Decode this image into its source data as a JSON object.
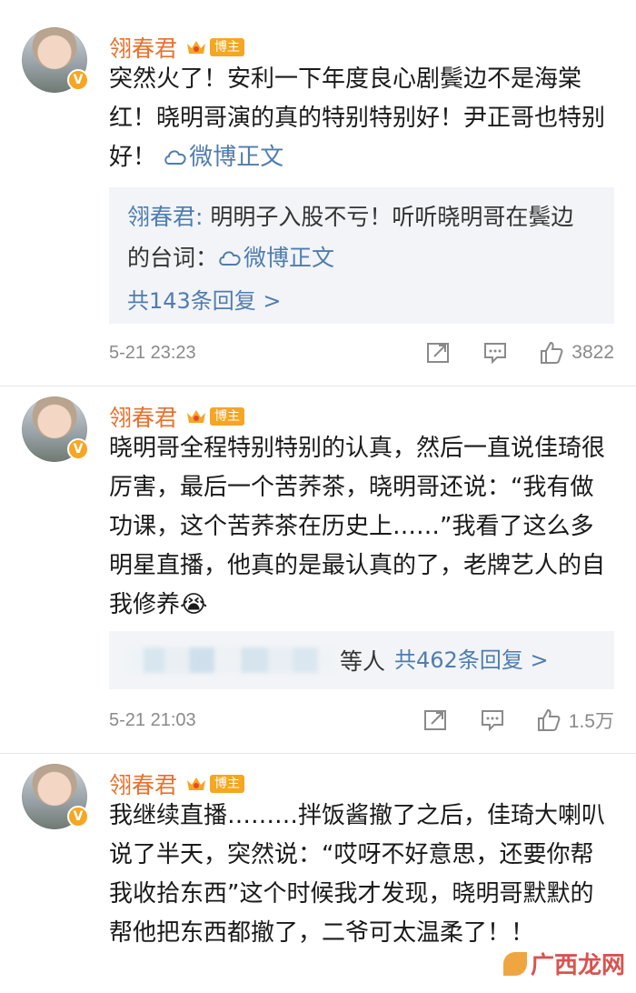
{
  "posts": [
    {
      "username": "翎春君",
      "tag": "博主",
      "text": "突然火了！安利一下年度良心剧鬓边不是海棠红！晓明哥演的真的特别特别好！尹正哥也特别好！",
      "link_label": "微博正文",
      "reply": {
        "name": "翎春君:",
        "text": " 明明子入股不亏！听听晓明哥在鬓边的台词：",
        "link_label": "微博正文",
        "more": "共143条回复 >"
      },
      "time": "5-21 23:23",
      "likes": "3822"
    },
    {
      "username": "翎春君",
      "tag": "博主",
      "text": "晓明哥全程特别特别的认真，然后一直说佳琦很厉害，最后一个苦荞茶，晓明哥还说：“我有做功课，这个苦荞茶在历史上……”我看了这么多明星直播，他真的是最认真的了，老牌艺人的自我修养",
      "emoji": "😭",
      "reply": {
        "suffix": "等人",
        "more": "共462条回复 >"
      },
      "time": "5-21 21:03",
      "likes": "1.5万"
    },
    {
      "username": "翎春君",
      "tag": "博主",
      "text": "我继续直播………拌饭酱撤了之后，佳琦大喇叭说了半天，突然说：“哎呀不好意思，还要你帮我收拾东西”这个时候我才发现，晓明哥默默的帮他把东西都撤了，二爷可太温柔了！！"
    }
  ],
  "watermark": "广西龙网",
  "colors": {
    "username": "#e8712d",
    "link": "#507daf",
    "tag_bg": "#f5a623",
    "reply_bg": "#f2f4f7",
    "meta": "#8a8a8a"
  },
  "icons": [
    "verified-badge-icon",
    "crown-icon",
    "weibo-link-icon",
    "repost-icon",
    "comment-icon",
    "like-icon"
  ]
}
